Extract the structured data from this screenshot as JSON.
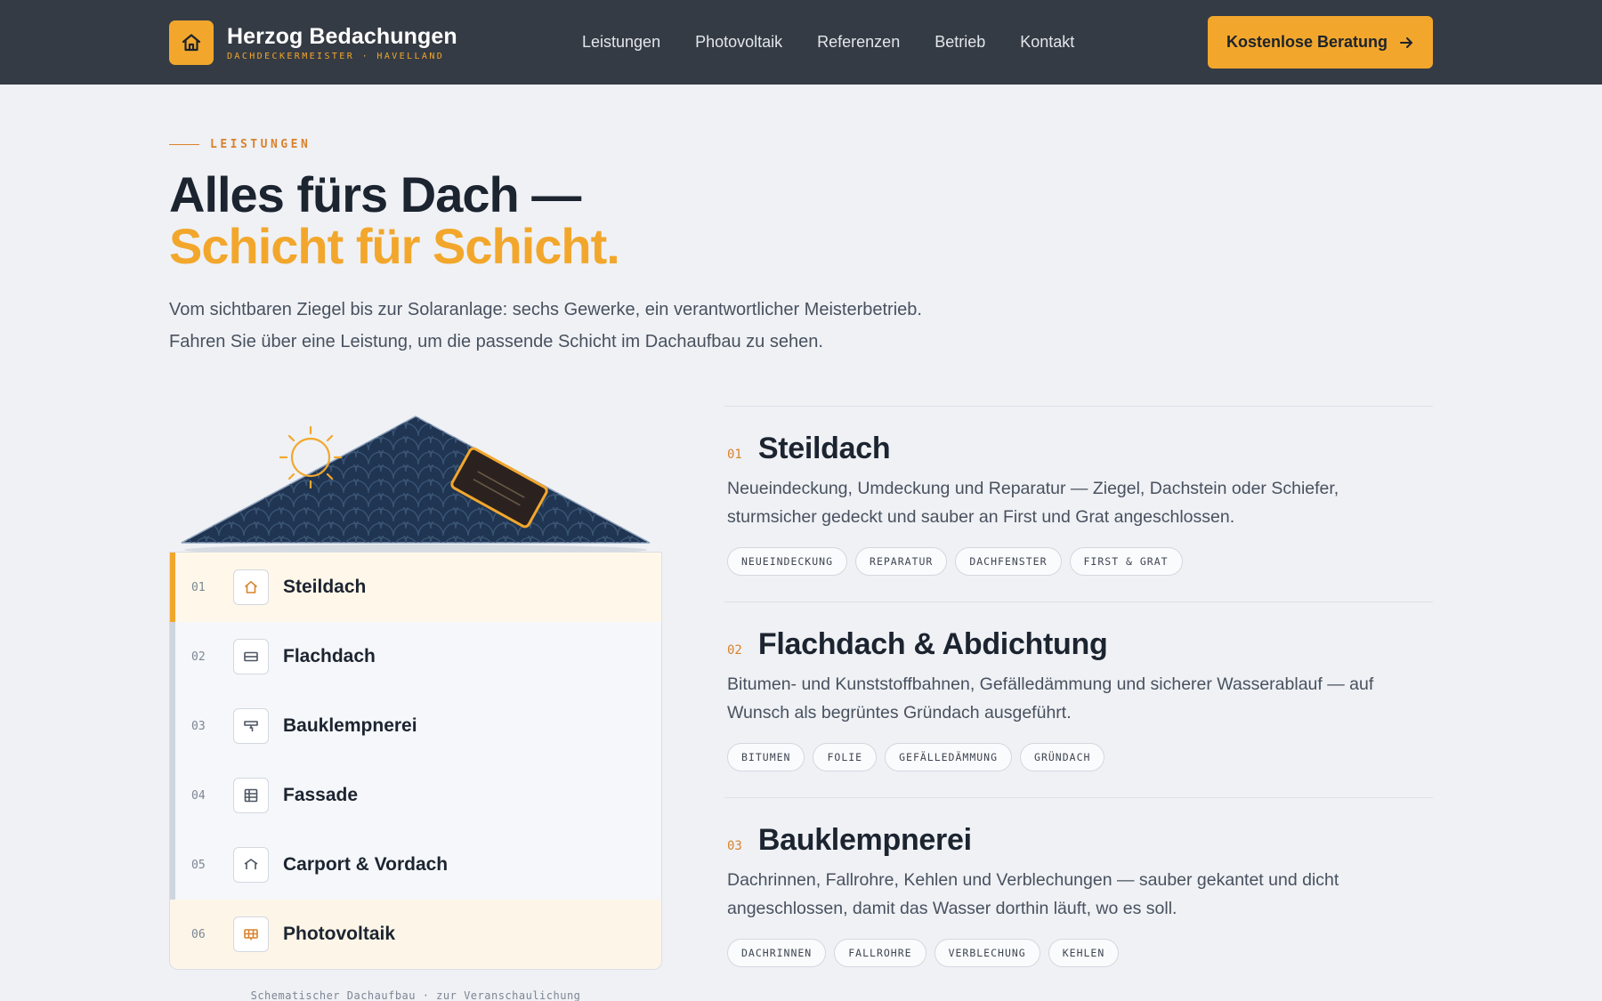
{
  "header": {
    "brand_name": "Herzog Bedachungen",
    "brand_sub": "DACHDECKERMEISTER · HAVELLAND",
    "nav": [
      "Leistungen",
      "Photovoltaik",
      "Referenzen",
      "Betrieb",
      "Kontakt"
    ],
    "cta_label": "Kostenlose Beratung"
  },
  "intro": {
    "eyebrow": "LEISTUNGEN",
    "title_line1": "Alles fürs Dach —",
    "title_line2": "Schicht für Schicht.",
    "lead_line1": "Vom sichtbaren Ziegel bis zur Solaranlage: sechs Gewerke, ein verantwortlicher Meisterbetrieb.",
    "lead_line2": "Fahren Sie über eine Leistung, um die passende Schicht im Dachaufbau zu sehen."
  },
  "layers": [
    {
      "num": "01",
      "label": "Steildach",
      "icon": "house-icon"
    },
    {
      "num": "02",
      "label": "Flachdach",
      "icon": "flat-roof-icon"
    },
    {
      "num": "03",
      "label": "Bauklempnerei",
      "icon": "gutter-icon"
    },
    {
      "num": "04",
      "label": "Fassade",
      "icon": "facade-grid-icon"
    },
    {
      "num": "05",
      "label": "Carport & Vordach",
      "icon": "carport-icon"
    },
    {
      "num": "06",
      "label": "Photovoltaik",
      "icon": "solar-panel-icon"
    }
  ],
  "caption": "Schematischer Dachaufbau · zur Veranschaulichung",
  "services": [
    {
      "num": "01",
      "title": "Steildach",
      "desc": "Neueindeckung, Umdeckung und Reparatur — Ziegel, Dachstein oder Schiefer, sturmsicher gedeckt und sauber an First und Grat angeschlossen.",
      "tags": [
        "NEUEINDECKUNG",
        "REPARATUR",
        "DACHFENSTER",
        "FIRST & GRAT"
      ]
    },
    {
      "num": "02",
      "title": "Flachdach & Abdichtung",
      "desc": "Bitumen- und Kunststoffbahnen, Gefälledämmung und sicherer Wasserablauf — auf Wunsch als begrüntes Gründach ausgeführt.",
      "tags": [
        "BITUMEN",
        "FOLIE",
        "GEFÄLLEDÄMMUNG",
        "GRÜNDACH"
      ]
    },
    {
      "num": "03",
      "title": "Bauklempnerei",
      "desc": "Dachrinnen, Fallrohre, Kehlen und Verblechungen — sauber gekantet und dicht angeschlossen, damit das Wasser dorthin läuft, wo es soll.",
      "tags": [
        "DACHRINNEN",
        "FALLROHRE",
        "VERBLECHUNG",
        "KEHLEN"
      ]
    }
  ],
  "colors": {
    "accent": "#f2a72c",
    "dark": "#353b44",
    "roof": "#1f3552"
  }
}
